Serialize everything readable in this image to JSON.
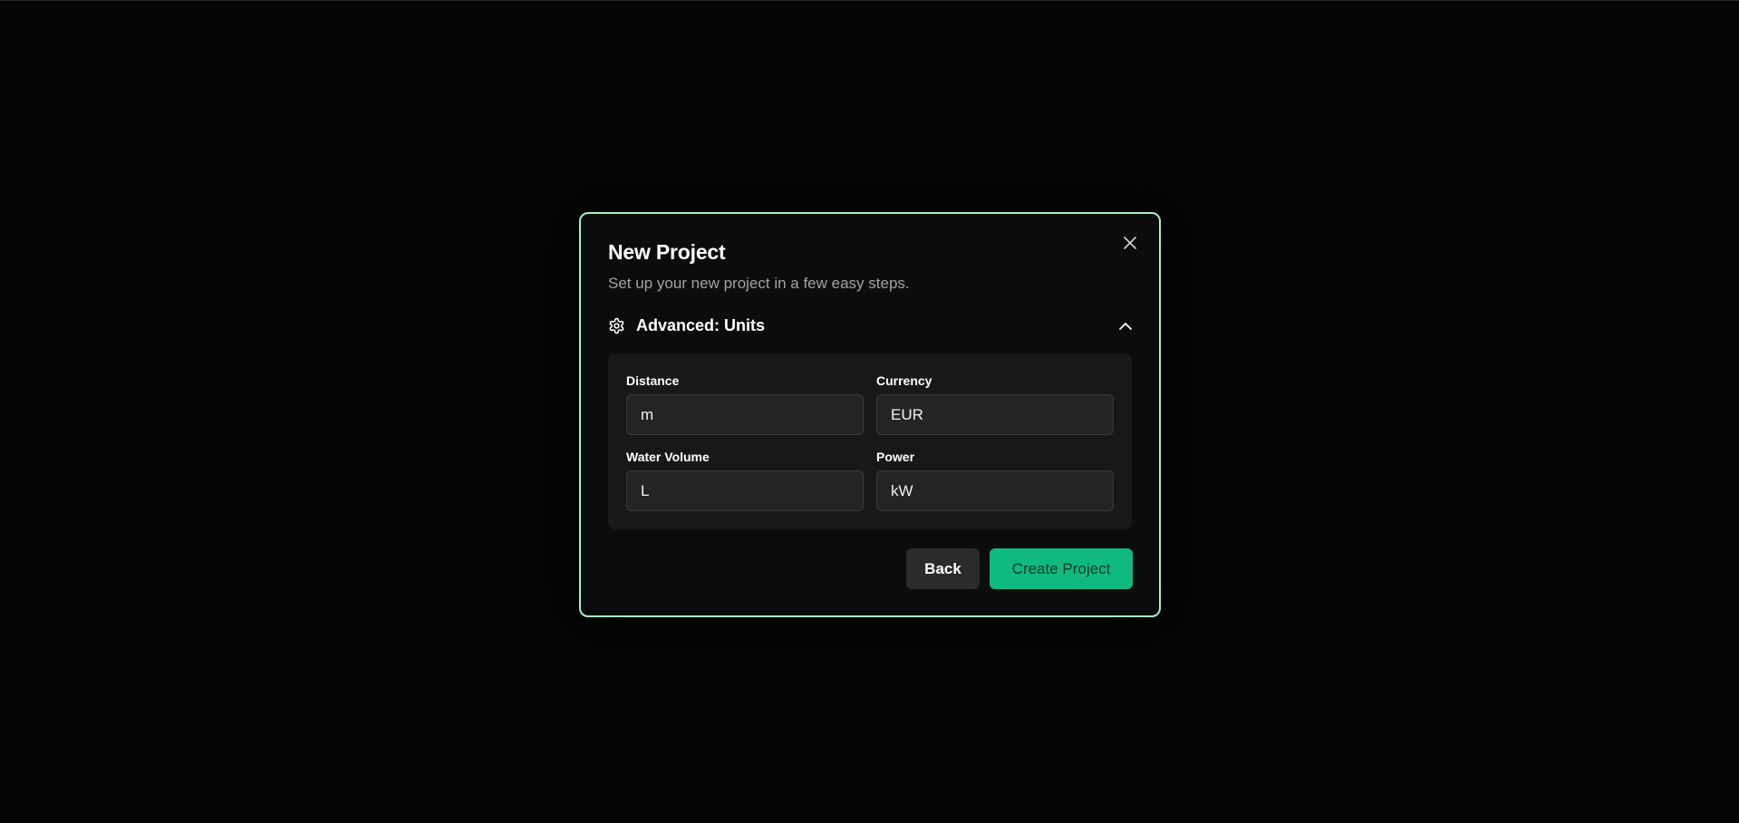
{
  "dialog": {
    "title": "New Project",
    "subtitle": "Set up your new project in a few easy steps.",
    "close_icon": "close-icon",
    "accent_border_color": "#a8efc4"
  },
  "advanced_section": {
    "icon": "gear-icon",
    "label": "Advanced: Units",
    "toggle_icon": "chevron-up-icon",
    "expanded": true
  },
  "units": {
    "distance": {
      "label": "Distance",
      "value": "m"
    },
    "currency": {
      "label": "Currency",
      "value": "EUR"
    },
    "water_volume": {
      "label": "Water Volume",
      "value": "L"
    },
    "power": {
      "label": "Power",
      "value": "kW"
    }
  },
  "footer": {
    "back_label": "Back",
    "create_label": "Create Project",
    "create_color": "#10b981"
  }
}
